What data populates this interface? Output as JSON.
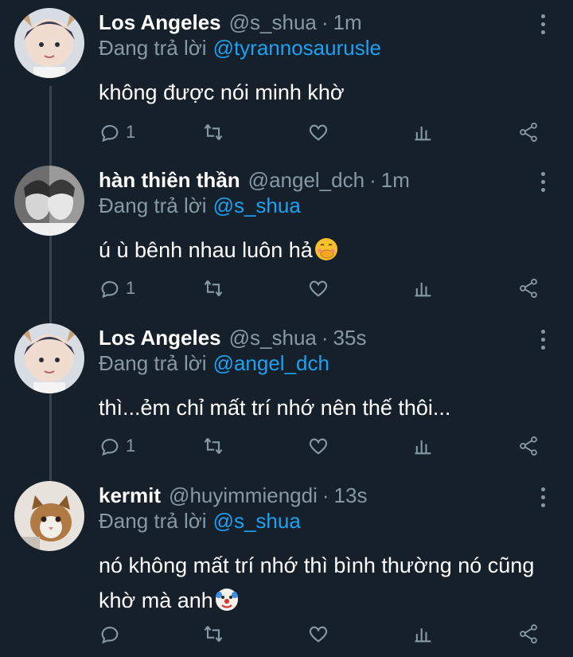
{
  "tweets": [
    {
      "name": "Los Angeles",
      "handle": "@s_shua",
      "time": "1m",
      "replying_label": "Đang trả lời",
      "replying_to": "@tyrannosaurusle",
      "text": "không được nói minh khờ",
      "emoji": "",
      "reply_count": "1",
      "avatar": "anime-boy-avatar"
    },
    {
      "name": "hàn thiên thần",
      "handle": "@angel_dch",
      "time": "1m",
      "replying_label": "Đang trả lời",
      "replying_to": "@s_shua",
      "text": "ú ù bênh nhau luôn hả",
      "emoji": "hand-over-mouth",
      "reply_count": "1",
      "avatar": "grayscale-couple-avatar"
    },
    {
      "name": "Los Angeles",
      "handle": "@s_shua",
      "time": "35s",
      "replying_label": "Đang trả lời",
      "replying_to": "@angel_dch",
      "text": "thì...ẻm chỉ mất trí nhớ nên thế thôi...",
      "emoji": "",
      "reply_count": "1",
      "avatar": "anime-boy-avatar"
    },
    {
      "name": "kermit",
      "handle": "@huyimmiengdi",
      "time": "13s",
      "replying_label": "Đang trả lời",
      "replying_to": "@s_shua",
      "text": "nó không mất trí nhớ thì bình thường nó cũng khờ mà anh",
      "emoji": "clown-face",
      "reply_count": "",
      "avatar": "cat-avatar"
    }
  ],
  "colors": {
    "background": "#15202b",
    "secondary_text": "#8899a6",
    "link": "#1da1f2",
    "thread_line": "#38444d"
  },
  "icons": [
    "reply-icon",
    "retweet-icon",
    "like-icon",
    "analytics-icon",
    "share-icon",
    "more-icon"
  ]
}
